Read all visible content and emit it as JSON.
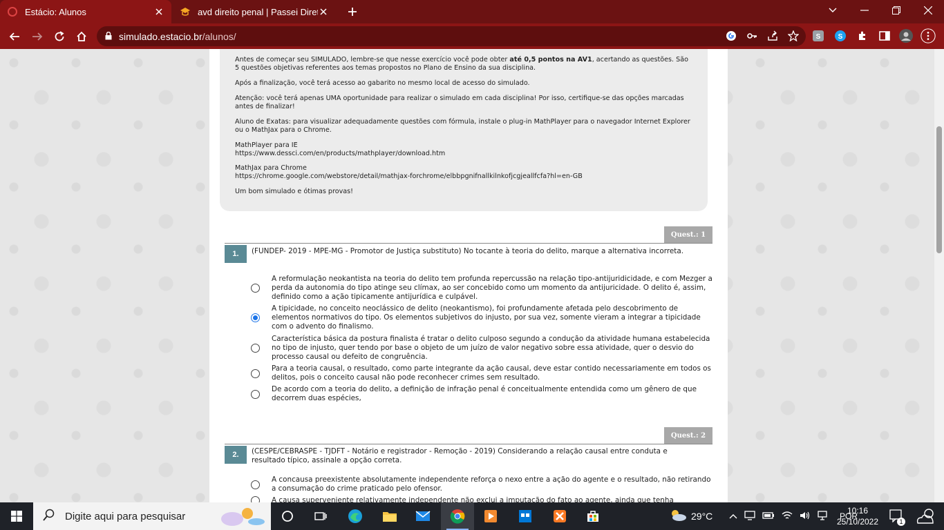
{
  "browser": {
    "tabs": [
      {
        "title": "Estácio: Alunos",
        "active": true
      },
      {
        "title": "avd direito penal | Passei Direto",
        "active": false
      }
    ],
    "url": {
      "host": "simulado.estacio.br",
      "path": "/alunos/"
    },
    "colors": {
      "frame": "#6b1212",
      "toolbar": "#8c1515"
    }
  },
  "notice": {
    "p1_before": "Antes de começar seu SIMULADO, lembre-se que nesse exercício você pode obter ",
    "p1_bold": "até 0,5 pontos na AV1",
    "p1_after": ", acertando as questões. São 5 questões objetivas referentes aos temas propostos no Plano de Ensino da sua disciplina.",
    "p2": "Após a finalização, você terá acesso ao gabarito no mesmo local de acesso do simulado.",
    "p3": "Atenção: você terá apenas UMA oportunidade para realizar o simulado em cada disciplina! Por isso, certifique-se das opções marcadas antes de finalizar!",
    "p4": "Aluno de Exatas: para visualizar adequadamente questões com fórmula, instale o plug-in MathPlayer para o navegador Internet Explorer ou o MathJax para o Chrome.",
    "mathplayer_label": "MathPlayer para IE",
    "mathplayer_url": "https://www.dessci.com/en/products/mathplayer/download.htm",
    "mathjax_label": "MathJax para Chrome",
    "mathjax_url": "https://chrome.google.com/webstore/detail/mathjax-forchrome/elbbpgnifnallkilnkofjcgjeallfcfa?hl=en-GB",
    "closing": "Um bom simulado e ótimas provas!"
  },
  "questions": [
    {
      "badge": "Quest.: 1",
      "number": "1.",
      "text": "(FUNDEP- 2019 - MPE-MG - Promotor de Justiça substituto) No tocante à teoria do delito, marque a alternativa incorreta.",
      "options": [
        "A reformulação neokantista na teoria do delito tem profunda repercussão na relação tipo-antijuridicidade, e com Mezger a perda da autonomia do tipo atinge seu clímax, ao ser concebido como um momento da antijuricidade. O delito é, assim, definido como a ação tipicamente antijurídica e culpável.",
        "A tipicidade, no conceito neoclássico de delito (neokantismo), foi profundamente afetada pelo descobrimento de elementos normativos do tipo. Os elementos subjetivos do injusto, por sua vez, somente vieram a integrar a tipicidade com o advento do finalismo.",
        "Característica básica da postura finalista é tratar o delito culposo segundo a condução da atividade humana estabelecida no tipo de injusto, quer tendo por base o objeto de um juízo de valor negativo sobre essa atividade, quer o desvio do processo causal ou defeito de congruência.",
        "Para a teoria causal, o resultado, como parte integrante da ação causal, deve estar contido necessariamente em todos os delitos, pois o conceito causal não pode reconhecer crimes sem resultado.",
        "De acordo com a teoria do delito, a definição de infração penal é conceitualmente entendida como um gênero de que decorrem duas espécies,"
      ],
      "selected_index": 1
    },
    {
      "badge": "Quest.: 2",
      "number": "2.",
      "text": "(CESPE/CEBRASPE - TJDFT - Notário e registrador - Remoção - 2019) Considerando a relação causal entre conduta e resultado típico, assinale a opção correta.",
      "options": [
        "A concausa preexistente absolutamente independente reforça o nexo entre a ação do agente e o resultado, não retirando a consumação do crime praticado pelo ofensor.",
        "A causa superveniente relativamente independente não exclui a imputação do fato ao agente, ainda que tenha"
      ]
    }
  ],
  "taskbar": {
    "search_placeholder": "Digite aqui para pesquisar",
    "temperature": "29°C",
    "language": "POR",
    "time": "10:16",
    "date": "25/10/2022",
    "notification_count": "1"
  }
}
